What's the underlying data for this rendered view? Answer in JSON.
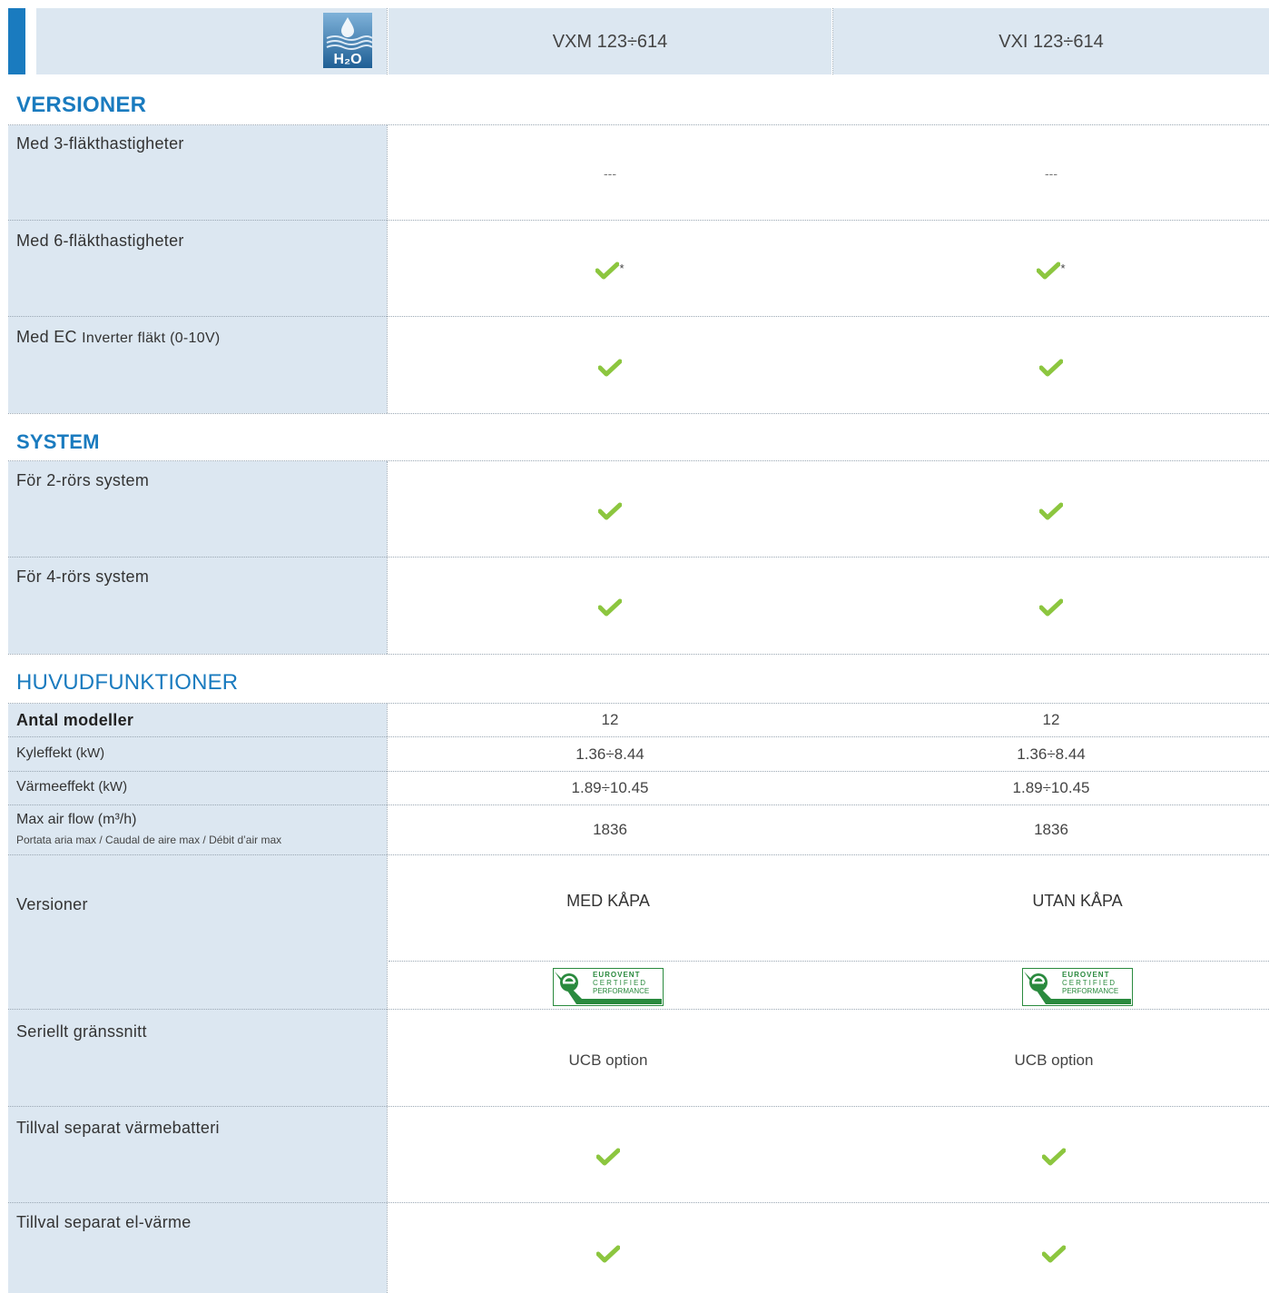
{
  "header": {
    "icon": "h2o-water-icon",
    "col1": "VXM 123÷614",
    "col2": "VXI 123÷614"
  },
  "sections": {
    "versioner": "VERSIONER",
    "system": "SYSTEM",
    "huvud": "HUVUDFUNKTIONER"
  },
  "versioner_rows": [
    {
      "label": "Med 3-fläkthastigheter",
      "c1": "---",
      "c2": "---"
    },
    {
      "label": "Med 6-fläkthastigheter",
      "c1_mark": "*",
      "c2_mark": "*"
    },
    {
      "label_a": "Med EC ",
      "label_b": "Inverter fläkt (0-10V)"
    }
  ],
  "system_rows": [
    {
      "label": "För 2-rörs system"
    },
    {
      "label": "För 4-rörs system"
    }
  ],
  "huvud_rows": {
    "antal": {
      "label": "Antal modeller",
      "c1": "12",
      "c2": "12"
    },
    "kyl": {
      "label_a": "Kyleffekt ",
      "label_b": "(kW)",
      "c1": "1.36÷8.44",
      "c2": "1.36÷8.44"
    },
    "varme": {
      "label_a": "Värmeeffekt ",
      "label_b": "(kW)",
      "c1": "1.89÷10.45",
      "c2": "1.89÷10.45"
    },
    "airflow": {
      "label": "Max air flow (m³/h)",
      "sub": "Portata aria max / Caudal de aire max / Débit d’air max",
      "c1": "1836",
      "c2": "1836"
    },
    "versioner": {
      "label": "Versioner",
      "c1": "MED KÅPA",
      "c2": "UTAN KÅPA"
    },
    "eurovent": {
      "line1": "EUROVENT",
      "line2": "CERTIFIED",
      "line3": "PERFORMANCE"
    },
    "seriellt": {
      "label": "Seriellt gränssnitt",
      "c1": "UCB option",
      "c2": "UCB option"
    },
    "tillval1": {
      "label": "Tillval separat värmebatteri"
    },
    "tillval2": {
      "label": "Tillval separat el-värme"
    }
  },
  "colors": {
    "accent": "#1a7bbf",
    "label_bg": "#dce7f1",
    "check": "#8cc63f"
  }
}
